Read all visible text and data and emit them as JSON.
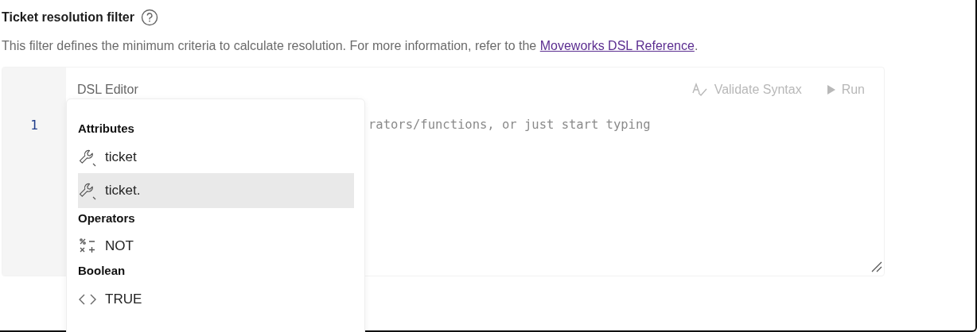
{
  "heading": {
    "title": "Ticket resolution filter"
  },
  "description": {
    "text": "This filter defines the minimum criteria to calculate resolution. For more information, refer to the ",
    "link": "Moveworks DSL Reference",
    "suffix": "."
  },
  "editor": {
    "title": "DSL Editor",
    "actions": [
      {
        "label": "Validate Syntax",
        "kind": "validate",
        "disabled": true
      },
      {
        "label": "Run",
        "kind": "run",
        "disabled": true
      }
    ],
    "line_numbers": [
      "1"
    ],
    "placeholder": "rators/functions, or just start typing"
  },
  "suggestions": {
    "groups": [
      {
        "label": "Attributes",
        "items": [
          {
            "label": "ticket",
            "kind": "attribute",
            "selected": false
          },
          {
            "label": "ticket.",
            "kind": "attribute",
            "selected": true
          }
        ]
      },
      {
        "label": "Operators",
        "items": [
          {
            "label": "NOT",
            "kind": "operator",
            "selected": false
          }
        ]
      },
      {
        "label": "Boolean",
        "items": [
          {
            "label": "TRUE",
            "kind": "boolean",
            "selected": false
          }
        ]
      }
    ]
  }
}
